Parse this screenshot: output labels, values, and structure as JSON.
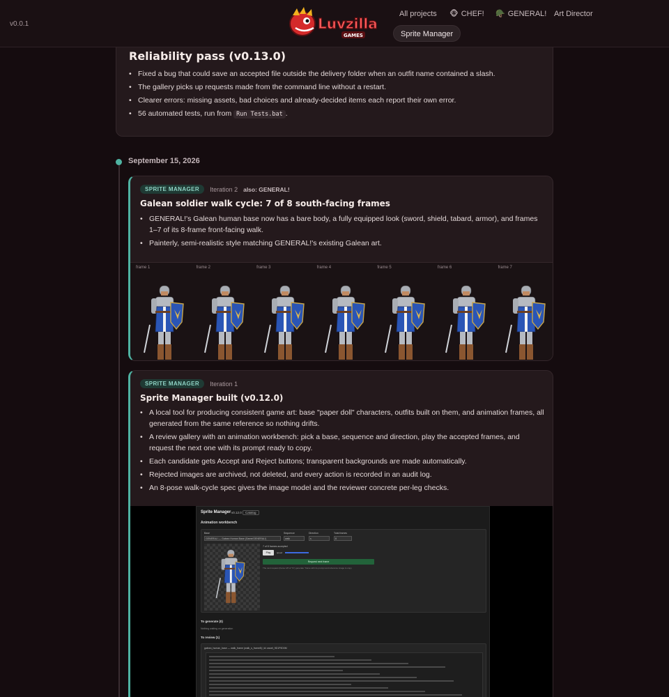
{
  "header": {
    "version": "v0.0.1",
    "logo_text": "Luvzilla",
    "logo_sub": "GAMES",
    "nav": [
      {
        "label": "All projects",
        "icon": ""
      },
      {
        "label": "CHEF!",
        "icon": "chef-icon"
      },
      {
        "label": "GENERAL!",
        "icon": "helmet-icon"
      },
      {
        "label": "Art Director",
        "icon": ""
      },
      {
        "label": "Sprite Manager",
        "icon": "",
        "active": true
      }
    ]
  },
  "release": {
    "title": "Reliability pass (v0.13.0)",
    "bullets": [
      "Fixed a bug that could save an accepted file outside the delivery folder when an outfit name contained a slash.",
      "The gallery picks up requests made from the command line without a restart.",
      "Clearer errors: missing assets, bad choices and already-decided items each report their own error."
    ],
    "tests_prefix": "56 automated tests, run from",
    "tests_code": "Run Tests.bat",
    "tests_suffix": "."
  },
  "timeline": {
    "date": "September 15, 2026"
  },
  "entry1": {
    "badge": "SPRITE MANAGER",
    "iteration": "Iteration 2",
    "also": "also: GENERAL!",
    "title": "Galean soldier walk cycle: 7 of 8 south-facing frames",
    "bullets": [
      "GENERAL!'s Galean human base now has a bare body, a fully equipped look (sword, shield, tabard, armor), and frames 1–7 of its 8-frame front-facing walk.",
      "Painterly, semi-realistic style matching GENERAL!'s existing Galean art."
    ],
    "frames": [
      "frame 1",
      "frame 2",
      "frame 3",
      "frame 4",
      "frame 5",
      "frame 6",
      "frame 7"
    ]
  },
  "entry2": {
    "badge": "SPRITE MANAGER",
    "iteration": "Iteration 1",
    "title": "Sprite Manager built (v0.12.0)",
    "bullets": [
      "A local tool for producing consistent game art: base \"paper doll\" characters, outfits built on them, and animation frames, all generated from the same reference so nothing drifts.",
      "A review gallery with an animation workbench: pick a base, sequence and direction, play the accepted frames, and request the next one with its prompt ready to copy.",
      "Each candidate gets Accept and Reject buttons; transparent backgrounds are made automatically.",
      "Rejected images are archived, not deleted, and every action is recorded in an audit log.",
      "An 8-pose walk-cycle spec gives the image model and the reviewer concrete per-leg checks."
    ],
    "screenshot": {
      "app_title": "Sprite Manager",
      "app_version": "v0.12.0",
      "catalog_btn": "Catalog",
      "workbench": "Animation workbench",
      "base_label": "Base",
      "base_value": "GENERAL! — Galean Human Base (Game/GENERAL!)",
      "sequence_label": "Sequence",
      "sequence_value": "walk",
      "direction_label": "Direction",
      "direction_value": "s",
      "total_label": "Total frames",
      "total_value": "8",
      "accepted": "7 of 8 frames accepted",
      "play": "Play",
      "speed": "speed",
      "request_btn": "Request next frame",
      "request_note": "The next request (frame 1/8 of \"S\") generate \"frame with its prompt and reference image to copy.",
      "to_generate": "To generate (0)",
      "to_generate_note": "Nothing waiting on generation",
      "to_review": "To review (1)",
      "review_item": "galean_human_base — walk_frame (walk_s_frame8) | id: asset_9D1F9D0M"
    }
  }
}
